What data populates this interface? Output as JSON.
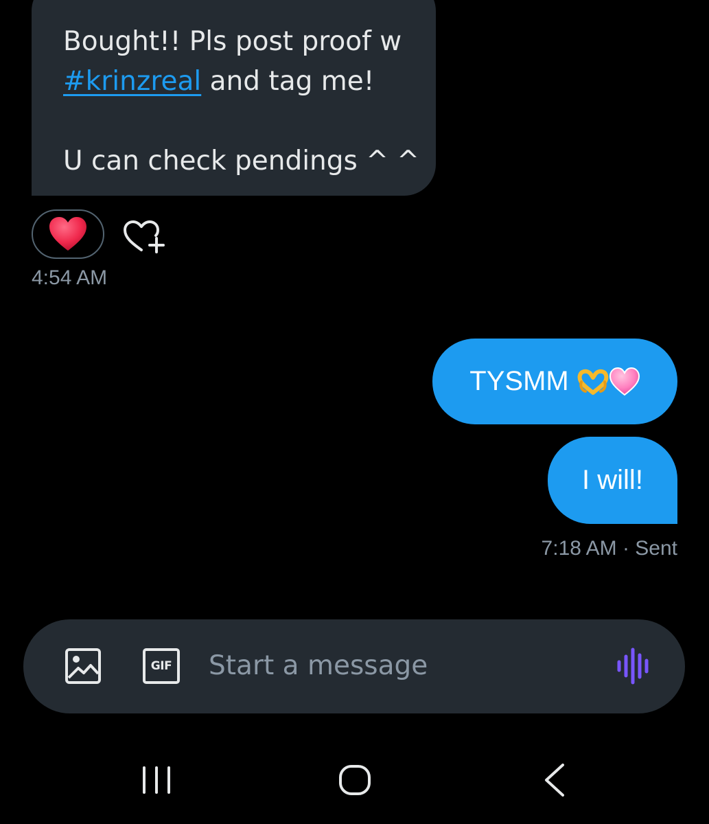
{
  "conversation": {
    "incoming": {
      "line1": "Bought!! Pls post proof w",
      "hashtag": "#krinzreal",
      "line2_rest": " and tag me!",
      "line3": "U can check pendings ^ ^",
      "reaction": "heart",
      "time": "4:54 AM"
    },
    "outgoing": [
      {
        "text": "TYSMM"
      },
      {
        "text": "I will!"
      }
    ],
    "outgoing_status": "7:18 AM · Sent"
  },
  "composer": {
    "placeholder": "Start a message",
    "gif_label": "GIF",
    "icons": [
      "image-icon",
      "gif-icon",
      "voice-message-icon"
    ]
  },
  "colors": {
    "background": "#000000",
    "incoming_bubble": "#242b32",
    "outgoing_bubble": "#1d9bf0",
    "link": "#1d9bf0",
    "muted_text": "#8b98a5",
    "voice_icon": "#7856ff"
  },
  "system_nav": {
    "icons": [
      "recent-apps-icon",
      "home-icon",
      "back-icon"
    ]
  }
}
